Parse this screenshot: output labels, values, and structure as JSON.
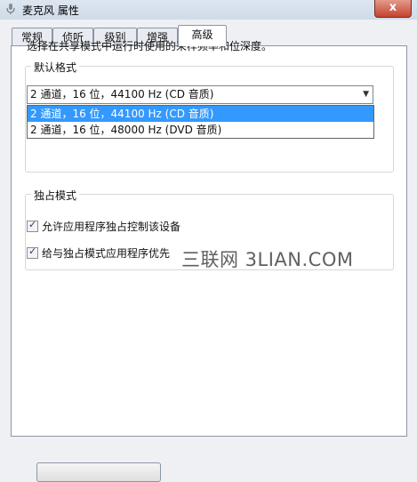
{
  "window": {
    "title": "麦克风 属性",
    "close_glyph": "x"
  },
  "tabs": [
    {
      "label": "常规"
    },
    {
      "label": "侦听"
    },
    {
      "label": "级别"
    },
    {
      "label": "增强"
    },
    {
      "label": "高级"
    }
  ],
  "default_format": {
    "group_title": "默认格式",
    "description": "选择在共享模式中运行时使用的采样频率和位深度。",
    "selected_value": "2 通道，16 位，44100 Hz (CD 音质)",
    "options": [
      {
        "label": "2 通道，16 位，44100 Hz (CD 音质)",
        "selected": true
      },
      {
        "label": "2 通道，16 位，48000 Hz (DVD 音质)",
        "selected": false
      }
    ]
  },
  "exclusive_mode": {
    "group_title": "独占模式",
    "checkboxes": [
      {
        "label": "允许应用程序独占控制该设备",
        "checked": true
      },
      {
        "label": "给与独占模式应用程序优先",
        "checked": true
      }
    ]
  },
  "watermark": "三联网 3LIAN.COM",
  "colors": {
    "selection": "#3399ff",
    "close_button": "#c6442e"
  }
}
